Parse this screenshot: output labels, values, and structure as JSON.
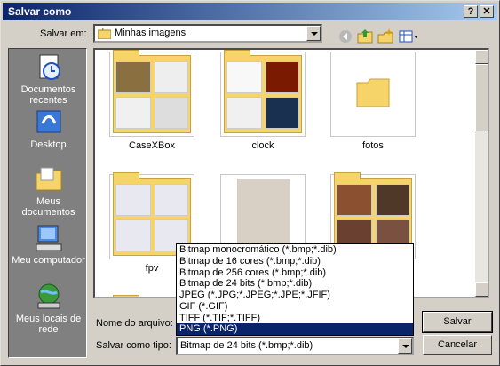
{
  "window": {
    "title": "Salvar como",
    "help_glyph": "?",
    "close_glyph": "✕"
  },
  "save_in": {
    "label": "Salvar em:",
    "value": "Minhas imagens"
  },
  "places": [
    {
      "label": "Documentos recentes",
      "icon": "recent-docs-icon"
    },
    {
      "label": "Desktop",
      "icon": "desktop-icon"
    },
    {
      "label": "Meus documentos",
      "icon": "my-docs-icon"
    },
    {
      "label": "Meu computador",
      "icon": "my-computer-icon"
    },
    {
      "label": "Meus locais de rede",
      "icon": "network-icon"
    }
  ],
  "files": [
    {
      "name": "CaseXBox"
    },
    {
      "name": "clock"
    },
    {
      "name": "fotos"
    },
    {
      "name": "fpv"
    },
    {
      "name": ""
    },
    {
      "name": ""
    }
  ],
  "file_name": {
    "label": "Nome do arquivo:",
    "value": ""
  },
  "file_type": {
    "label": "Salvar como tipo:",
    "value": "Bitmap de 24 bits (*.bmp;*.dib)",
    "options": [
      "Bitmap monocromático (*.bmp;*.dib)",
      "Bitmap de 16 cores (*.bmp;*.dib)",
      "Bitmap de 256 cores (*.bmp;*.dib)",
      "Bitmap de 24 bits (*.bmp;*.dib)",
      "JPEG (*.JPG;*.JPEG;*.JPE;*.JFIF)",
      "GIF (*.GIF)",
      "TIFF (*.TIF;*.TIFF)",
      "PNG (*.PNG)"
    ],
    "highlighted": "PNG (*.PNG)"
  },
  "buttons": {
    "save": "Salvar",
    "cancel": "Cancelar"
  },
  "colors": {
    "titlebar": "#0a246a",
    "places_bg": "#808080",
    "folder": "#f6d46a",
    "selection": "#0a246a"
  }
}
